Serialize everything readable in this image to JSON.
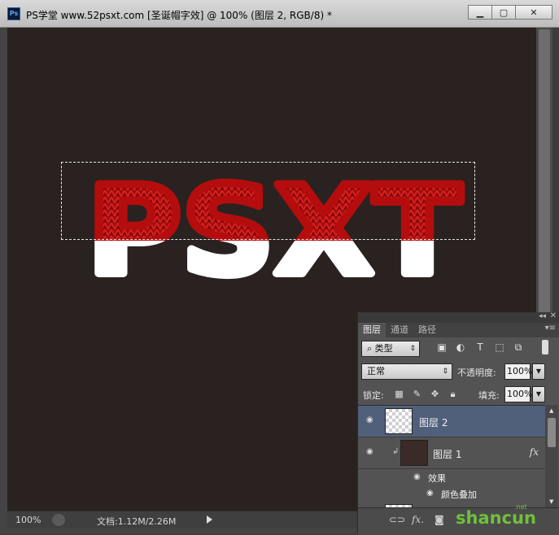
{
  "window": {
    "title": "PS学堂 www.52psxt.com [圣诞帽字效] @ 100% (图层 2, RGB/8) *",
    "app_icon": "Ps",
    "minimize_icon": "minimize-icon",
    "maximize_icon": "maximize-icon",
    "close_icon": "close-icon"
  },
  "canvas": {
    "artwork_text": "PSXT",
    "knit_color": "#b50d0d",
    "fill_color": "#ffffff",
    "background_color": "#2a2220"
  },
  "statusbar": {
    "zoom": "100%",
    "doc_info": "文档:1.12M/2.26M"
  },
  "layers_panel": {
    "tabs": [
      "图层",
      "通道",
      "路径"
    ],
    "active_tab": "图层",
    "filter_label": "类型",
    "blend_mode": "正常",
    "opacity_label": "不透明度:",
    "opacity_value": "100%",
    "lock_label": "锁定:",
    "fill_label": "填充:",
    "fill_value": "100%",
    "layers": [
      {
        "name": "图层 2",
        "selected": true
      },
      {
        "name": "图层 1",
        "fx": "fx"
      }
    ],
    "effects_label": "效果",
    "effect_name": "颜色叠加",
    "footer_icons": [
      "link-icon",
      "fx-icon",
      "mask-icon"
    ]
  },
  "watermark": {
    "text": "shancun",
    "small": ".net"
  }
}
